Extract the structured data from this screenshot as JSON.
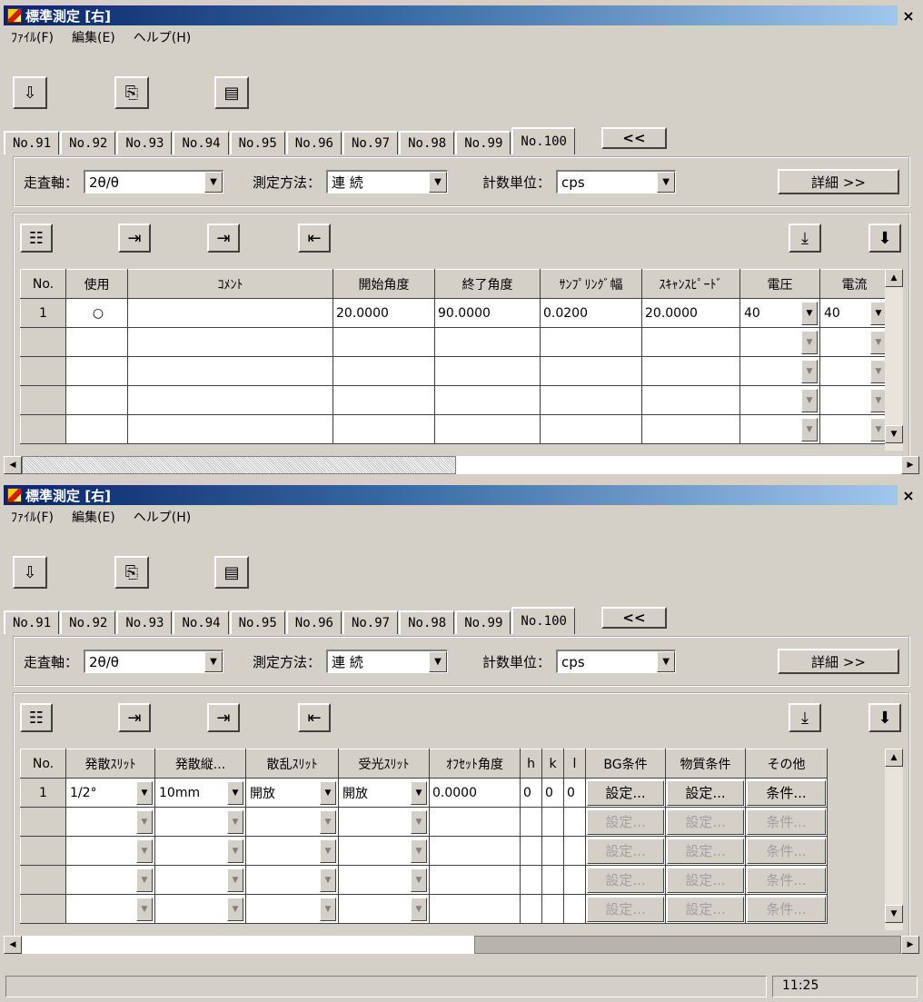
{
  "windows": [
    {
      "title": "標準測定 [右]",
      "close_label": "×",
      "menu": [
        "ﾌｧｲﾙ(F)",
        "編集(E)",
        "ヘルプ(H)"
      ],
      "toolbar_icons": [
        "import-icon",
        "copy-icon",
        "paste-icon"
      ],
      "tabs": [
        "No.91",
        "No.92",
        "No.93",
        "No.94",
        "No.95",
        "No.96",
        "No.97",
        "No.98",
        "No.99",
        "No.100"
      ],
      "active_tab": "No.100",
      "collapse_label": "<<",
      "settings": {
        "scan_axis_label": "走査軸：",
        "scan_axis_value": "2θ/θ",
        "method_label": "測定方法：",
        "method_value": "連 続",
        "unit_label": "計数単位：",
        "unit_value": "cps",
        "detail_label": "詳細 >>"
      },
      "grid": {
        "columns": [
          "No.",
          "使用",
          "ｺﾒﾝﾄ",
          "開始角度",
          "終了角度",
          "ｻﾝﾌﾟﾘﾝｸﾞ幅",
          "ｽｷｬﾝｽﾋﾟｰﾄﾞ",
          "電圧",
          "電流"
        ],
        "rows": [
          {
            "no": "1",
            "use": "○",
            "comment": "",
            "start": "20.0000",
            "end": "90.0000",
            "step": "0.0200",
            "speed": "20.0000",
            "voltage": "40",
            "current": "40"
          },
          {
            "no": "",
            "use": "",
            "comment": "",
            "start": "",
            "end": "",
            "step": "",
            "speed": "",
            "voltage": "",
            "current": ""
          },
          {
            "no": "",
            "use": "",
            "comment": "",
            "start": "",
            "end": "",
            "step": "",
            "speed": "",
            "voltage": "",
            "current": ""
          },
          {
            "no": "",
            "use": "",
            "comment": "",
            "start": "",
            "end": "",
            "step": "",
            "speed": "",
            "voltage": "",
            "current": ""
          },
          {
            "no": "",
            "use": "",
            "comment": "",
            "start": "",
            "end": "",
            "step": "",
            "speed": "",
            "voltage": "",
            "current": ""
          }
        ]
      }
    },
    {
      "title": "標準測定 [右]",
      "close_label": "×",
      "menu": [
        "ﾌｧｲﾙ(F)",
        "編集(E)",
        "ヘルプ(H)"
      ],
      "tabs": [
        "No.91",
        "No.92",
        "No.93",
        "No.94",
        "No.95",
        "No.96",
        "No.97",
        "No.98",
        "No.99",
        "No.100"
      ],
      "active_tab": "No.100",
      "collapse_label": "<<",
      "settings": {
        "scan_axis_label": "走査軸：",
        "scan_axis_value": "2θ/θ",
        "method_label": "測定方法：",
        "method_value": "連 続",
        "unit_label": "計数単位：",
        "unit_value": "cps",
        "detail_label": "詳細 >>"
      },
      "grid": {
        "columns": [
          "No.",
          "発散ｽﾘｯﾄ",
          "発散縦...",
          "散乱ｽﾘｯﾄ",
          "受光ｽﾘｯﾄ",
          "ｵﾌｾｯﾄ角度",
          "h",
          "k",
          "l",
          "BG条件",
          "物質条件",
          "その他"
        ],
        "rows": [
          {
            "no": "1",
            "div_slit": "1/2°",
            "div_v": "10mm",
            "scat": "開放",
            "recv": "開放",
            "offset": "0.0000",
            "h": "0",
            "k": "0",
            "l": "0",
            "bg": "設定...",
            "mat": "設定...",
            "other": "条件..."
          },
          {
            "no": "",
            "div_slit": "",
            "div_v": "",
            "scat": "",
            "recv": "",
            "offset": "",
            "h": "",
            "k": "",
            "l": "",
            "bg": "設定...",
            "mat": "設定...",
            "other": "条件..."
          },
          {
            "no": "",
            "div_slit": "",
            "div_v": "",
            "scat": "",
            "recv": "",
            "offset": "",
            "h": "",
            "k": "",
            "l": "",
            "bg": "設定...",
            "mat": "設定...",
            "other": "条件..."
          },
          {
            "no": "",
            "div_slit": "",
            "div_v": "",
            "scat": "",
            "recv": "",
            "offset": "",
            "h": "",
            "k": "",
            "l": "",
            "bg": "設定...",
            "mat": "設定...",
            "other": "条件..."
          },
          {
            "no": "",
            "div_slit": "",
            "div_v": "",
            "scat": "",
            "recv": "",
            "offset": "",
            "h": "",
            "k": "",
            "l": "",
            "bg": "設定...",
            "mat": "設定...",
            "other": "条件..."
          }
        ]
      }
    }
  ],
  "status": {
    "time": "11:25"
  }
}
